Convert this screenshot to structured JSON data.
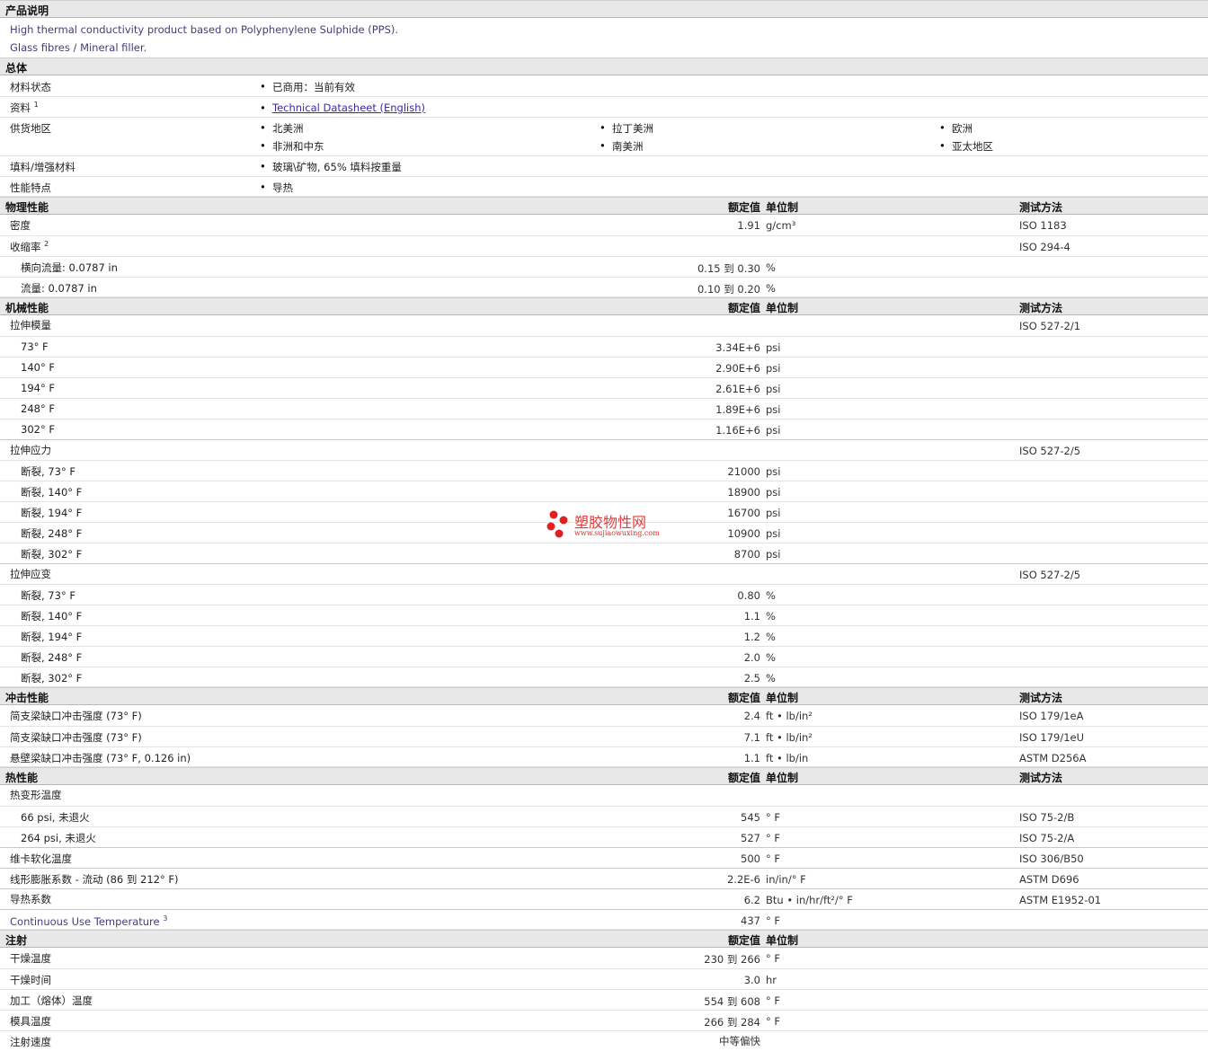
{
  "product": {
    "title": "产品说明",
    "line1": "High thermal conductivity product based on Polyphenylene Sulphide (PPS).",
    "line2": "Glass fibres / Mineral filler."
  },
  "general": {
    "title": "总体",
    "status_label": "材料状态",
    "status_value": "已商用：当前有效",
    "docs_label": "资料",
    "docs_sup": "1",
    "docs_link": "Technical Datasheet (English)",
    "region_label": "供货地区",
    "regions": [
      "北美洲",
      "拉丁美洲",
      "欧洲",
      "非洲和中东",
      "南美洲",
      "亚太地区"
    ],
    "filler_label": "填料/增强材料",
    "filler_value": "玻璃\\矿物, 65% 填料按重量",
    "feature_label": "性能特点",
    "feature_value": "导热"
  },
  "headers": {
    "value": "额定值",
    "unit": "单位制",
    "method": "测试方法"
  },
  "physical": {
    "title": "物理性能",
    "density": {
      "label": "密度",
      "value": "1.91",
      "unit": "g/cm³",
      "method": "ISO 1183"
    },
    "shrink": {
      "label": "收缩率",
      "sup": "2",
      "method": "ISO 294-4"
    },
    "shrink_tf": {
      "label": "横向流量: 0.0787 in",
      "value": "0.15 到  0.30",
      "unit": "%"
    },
    "shrink_f": {
      "label": "流量: 0.0787 in",
      "value": "0.10 到  0.20",
      "unit": "%"
    }
  },
  "mechanical": {
    "title": "机械性能",
    "modulus": {
      "label": "拉伸模量",
      "method": "ISO 527-2/1"
    },
    "modulus_rows": [
      {
        "label": "73° F",
        "value": "3.34E+6",
        "unit": "psi"
      },
      {
        "label": "140° F",
        "value": "2.90E+6",
        "unit": "psi"
      },
      {
        "label": "194° F",
        "value": "2.61E+6",
        "unit": "psi"
      },
      {
        "label": "248° F",
        "value": "1.89E+6",
        "unit": "psi"
      },
      {
        "label": "302° F",
        "value": "1.16E+6",
        "unit": "psi"
      }
    ],
    "stress": {
      "label": "拉伸应力",
      "method": "ISO 527-2/5"
    },
    "stress_rows": [
      {
        "label": "断裂, 73° F",
        "value": "21000",
        "unit": "psi"
      },
      {
        "label": "断裂, 140° F",
        "value": "18900",
        "unit": "psi"
      },
      {
        "label": "断裂, 194° F",
        "value": "16700",
        "unit": "psi"
      },
      {
        "label": "断裂, 248° F",
        "value": "10900",
        "unit": "psi"
      },
      {
        "label": "断裂, 302° F",
        "value": "8700",
        "unit": "psi"
      }
    ],
    "strain": {
      "label": "拉伸应变",
      "method": "ISO 527-2/5"
    },
    "strain_rows": [
      {
        "label": "断裂, 73° F",
        "value": "0.80",
        "unit": "%"
      },
      {
        "label": "断裂, 140° F",
        "value": "1.1",
        "unit": "%"
      },
      {
        "label": "断裂, 194° F",
        "value": "1.2",
        "unit": "%"
      },
      {
        "label": "断裂, 248° F",
        "value": "2.0",
        "unit": "%"
      },
      {
        "label": "断裂, 302° F",
        "value": "2.5",
        "unit": "%"
      }
    ]
  },
  "impact": {
    "title": "冲击性能",
    "rows": [
      {
        "label": "简支梁缺口冲击强度 (73° F)",
        "value": "2.4",
        "unit": "ft • lb/in²",
        "method": "ISO 179/1eA"
      },
      {
        "label": "简支梁缺口冲击强度 (73° F)",
        "value": "7.1",
        "unit": "ft • lb/in²",
        "method": "ISO 179/1eU"
      },
      {
        "label": "悬壁梁缺口冲击强度 (73° F, 0.126 in)",
        "value": "1.1",
        "unit": "ft • lb/in",
        "method": "ASTM D256A"
      }
    ]
  },
  "thermal": {
    "title": "热性能",
    "hdt_label": "热变形温度",
    "hdt_rows": [
      {
        "label": "66 psi, 未退火",
        "value": "545",
        "unit": "° F",
        "method": "ISO 75-2/B"
      },
      {
        "label": "264 psi, 未退火",
        "value": "527",
        "unit": "° F",
        "method": "ISO 75-2/A"
      }
    ],
    "rows": [
      {
        "label": "维卡软化温度",
        "value": "500",
        "unit": "° F",
        "method": "ISO 306/B50"
      },
      {
        "label": "线形膨胀系数 - 流动 (86 到  212° F)",
        "value": "2.2E-6",
        "unit": "in/in/° F",
        "method": "ASTM D696"
      },
      {
        "label": "导热系数",
        "value": "6.2",
        "unit": "Btu • in/hr/ft²/° F",
        "method": "ASTM E1952-01"
      }
    ],
    "cut": {
      "label": "Continuous Use Temperature",
      "sup": "3",
      "value": "437",
      "unit": "° F"
    }
  },
  "injection": {
    "title": "注射",
    "rows": [
      {
        "label": "干燥温度",
        "value": "230 到  266",
        "unit": "° F"
      },
      {
        "label": "干燥时间",
        "value": "3.0",
        "unit": "hr"
      },
      {
        "label": "加工（熔体）温度",
        "value": "554 到  608",
        "unit": "° F"
      },
      {
        "label": "模具温度",
        "value": "266 到  284",
        "unit": "° F"
      },
      {
        "label": "注射速度",
        "value": "中等偏快",
        "unit": ""
      }
    ]
  },
  "watermark": {
    "name": "塑胶物性网",
    "url": "www.sujiaowuxing.com",
    "color": "#e23b3b"
  }
}
